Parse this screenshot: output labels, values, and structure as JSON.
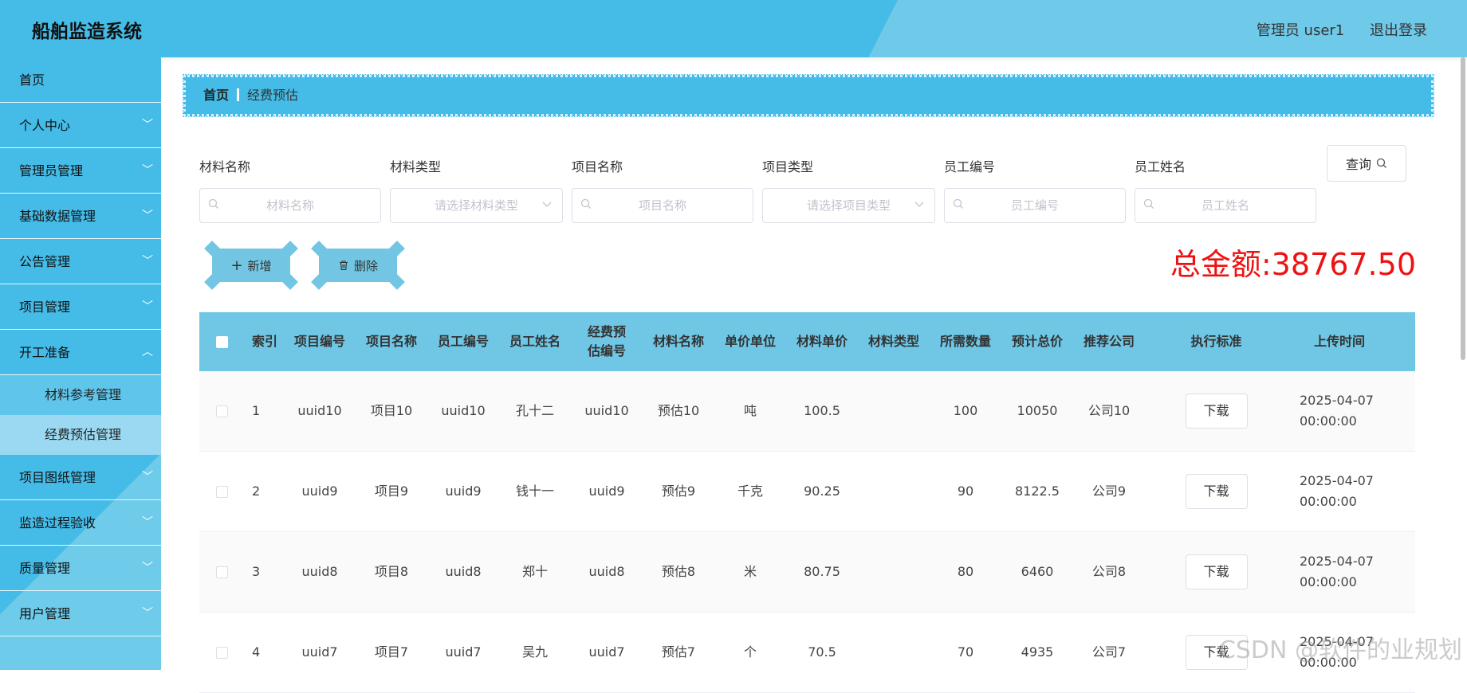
{
  "header": {
    "title": "船舶监造系统",
    "user": "管理员 user1",
    "logout": "退出登录"
  },
  "sidebar": {
    "items": [
      {
        "label": "首页"
      },
      {
        "label": "个人中心"
      },
      {
        "label": "管理员管理"
      },
      {
        "label": "基础数据管理"
      },
      {
        "label": "公告管理"
      },
      {
        "label": "项目管理"
      },
      {
        "label": "开工准备"
      },
      {
        "label": "项目图纸管理"
      },
      {
        "label": "监造过程验收"
      },
      {
        "label": "质量管理"
      },
      {
        "label": "用户管理"
      }
    ],
    "sub_items": [
      {
        "label": "材料参考管理"
      },
      {
        "label": "经费预估管理"
      }
    ]
  },
  "breadcrumb": {
    "home": "首页",
    "current": "经费预估"
  },
  "search": {
    "fields": [
      {
        "label": "材料名称",
        "placeholder": "材料名称"
      },
      {
        "label": "材料类型",
        "placeholder": "请选择材料类型"
      },
      {
        "label": "项目名称",
        "placeholder": "项目名称"
      },
      {
        "label": "项目类型",
        "placeholder": "请选择项目类型"
      },
      {
        "label": "员工编号",
        "placeholder": "员工编号"
      },
      {
        "label": "员工姓名",
        "placeholder": "员工姓名"
      }
    ],
    "query_label": "查询"
  },
  "actions": {
    "add_label": "新增",
    "delete_label": "删除",
    "total": "总金额:38767.50"
  },
  "table": {
    "columns": [
      "索引",
      "项目编号",
      "项目名称",
      "员工编号",
      "员工姓名",
      "经费预估编号",
      "材料名称",
      "单价单位",
      "材料单价",
      "材料类型",
      "所需数量",
      "预计总价",
      "推荐公司",
      "执行标准",
      "上传时间"
    ],
    "download_label": "下载",
    "rows": [
      {
        "idx": "1",
        "proj_no": "uuid10",
        "proj_name": "项目10",
        "emp_no": "uuid10",
        "emp_name": "孔十二",
        "est_no": "uuid10",
        "mat_name": "预估10",
        "unit": "吨",
        "price": "100.5",
        "mat_type": "",
        "qty": "100",
        "total": "10050",
        "company": "公司10",
        "time": "2025-04-07 00:00:00"
      },
      {
        "idx": "2",
        "proj_no": "uuid9",
        "proj_name": "项目9",
        "emp_no": "uuid9",
        "emp_name": "钱十一",
        "est_no": "uuid9",
        "mat_name": "预估9",
        "unit": "千克",
        "price": "90.25",
        "mat_type": "",
        "qty": "90",
        "total": "8122.5",
        "company": "公司9",
        "time": "2025-04-07 00:00:00"
      },
      {
        "idx": "3",
        "proj_no": "uuid8",
        "proj_name": "项目8",
        "emp_no": "uuid8",
        "emp_name": "郑十",
        "est_no": "uuid8",
        "mat_name": "预估8",
        "unit": "米",
        "price": "80.75",
        "mat_type": "",
        "qty": "80",
        "total": "6460",
        "company": "公司8",
        "time": "2025-04-07 00:00:00"
      },
      {
        "idx": "4",
        "proj_no": "uuid7",
        "proj_name": "项目7",
        "emp_no": "uuid7",
        "emp_name": "吴九",
        "est_no": "uuid7",
        "mat_name": "预估7",
        "unit": "个",
        "price": "70.5",
        "mat_type": "",
        "qty": "70",
        "total": "4935",
        "company": "公司7",
        "time": "2025-04-07 00:00:00"
      }
    ]
  },
  "watermark": "CSDN @软件的业规划"
}
